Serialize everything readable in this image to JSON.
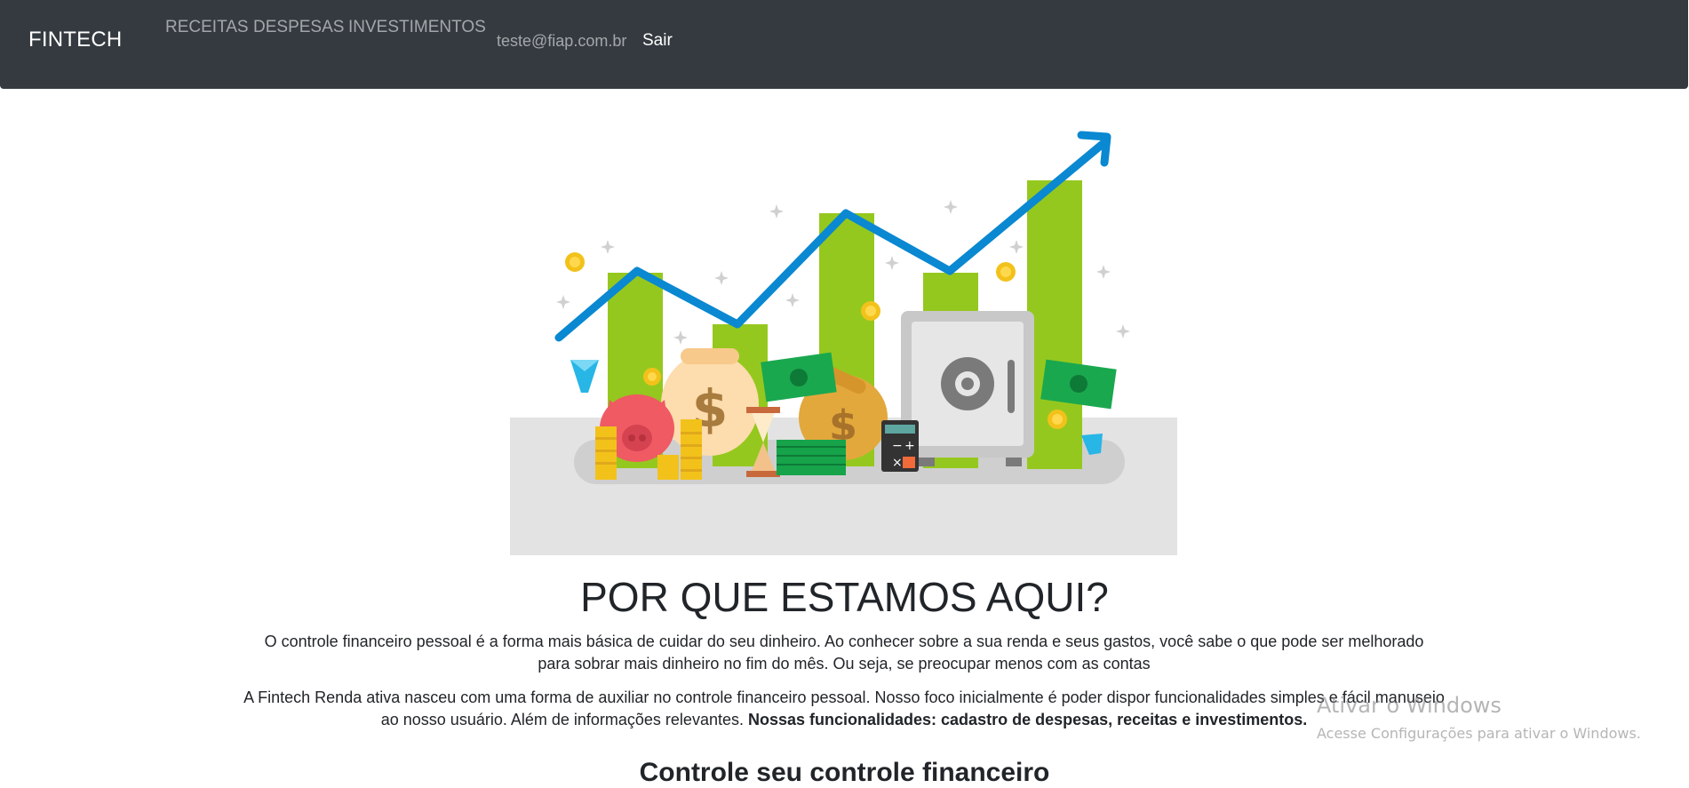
{
  "nav": {
    "brand": "FINTECH",
    "links": [
      "RECEITAS",
      "DESPESAS",
      "INVESTIMENTOS"
    ],
    "user_email": "teste@fiap.com.br",
    "logout_label": "Sair"
  },
  "hero": {
    "illustration": "financial-growth-illustration"
  },
  "main": {
    "title": "POR QUE ESTAMOS AQUI?",
    "paragraph1": "O controle financeiro pessoal é a forma mais básica de cuidar do seu dinheiro. Ao conhecer sobre a sua renda e seus gastos, você sabe o que pode ser melhorado para sobrar mais dinheiro no fim do mês. Ou seja, se preocupar menos com as contas",
    "paragraph2_text": "A Fintech Renda ativa nasceu com uma forma de auxiliar no controle financeiro pessoal. Nosso foco inicialmente é poder dispor funcionalidades simples e fácil manuseio ao nosso usuário. Além de informações relevantes. ",
    "paragraph2_bold": "Nossas funcionalidades: cadastro de despesas, receitas e investimentos.",
    "subtitle_partial": "Controle seu controle financeiro"
  },
  "watermark": {
    "title": "Ativar o Windows",
    "subtitle": "Acesse Configurações para ativar o Windows."
  },
  "colors": {
    "navbar_bg": "#343a40",
    "bar_green": "#95c81e",
    "trend_line": "#0a88d1",
    "platform": "#e3e3e3"
  }
}
